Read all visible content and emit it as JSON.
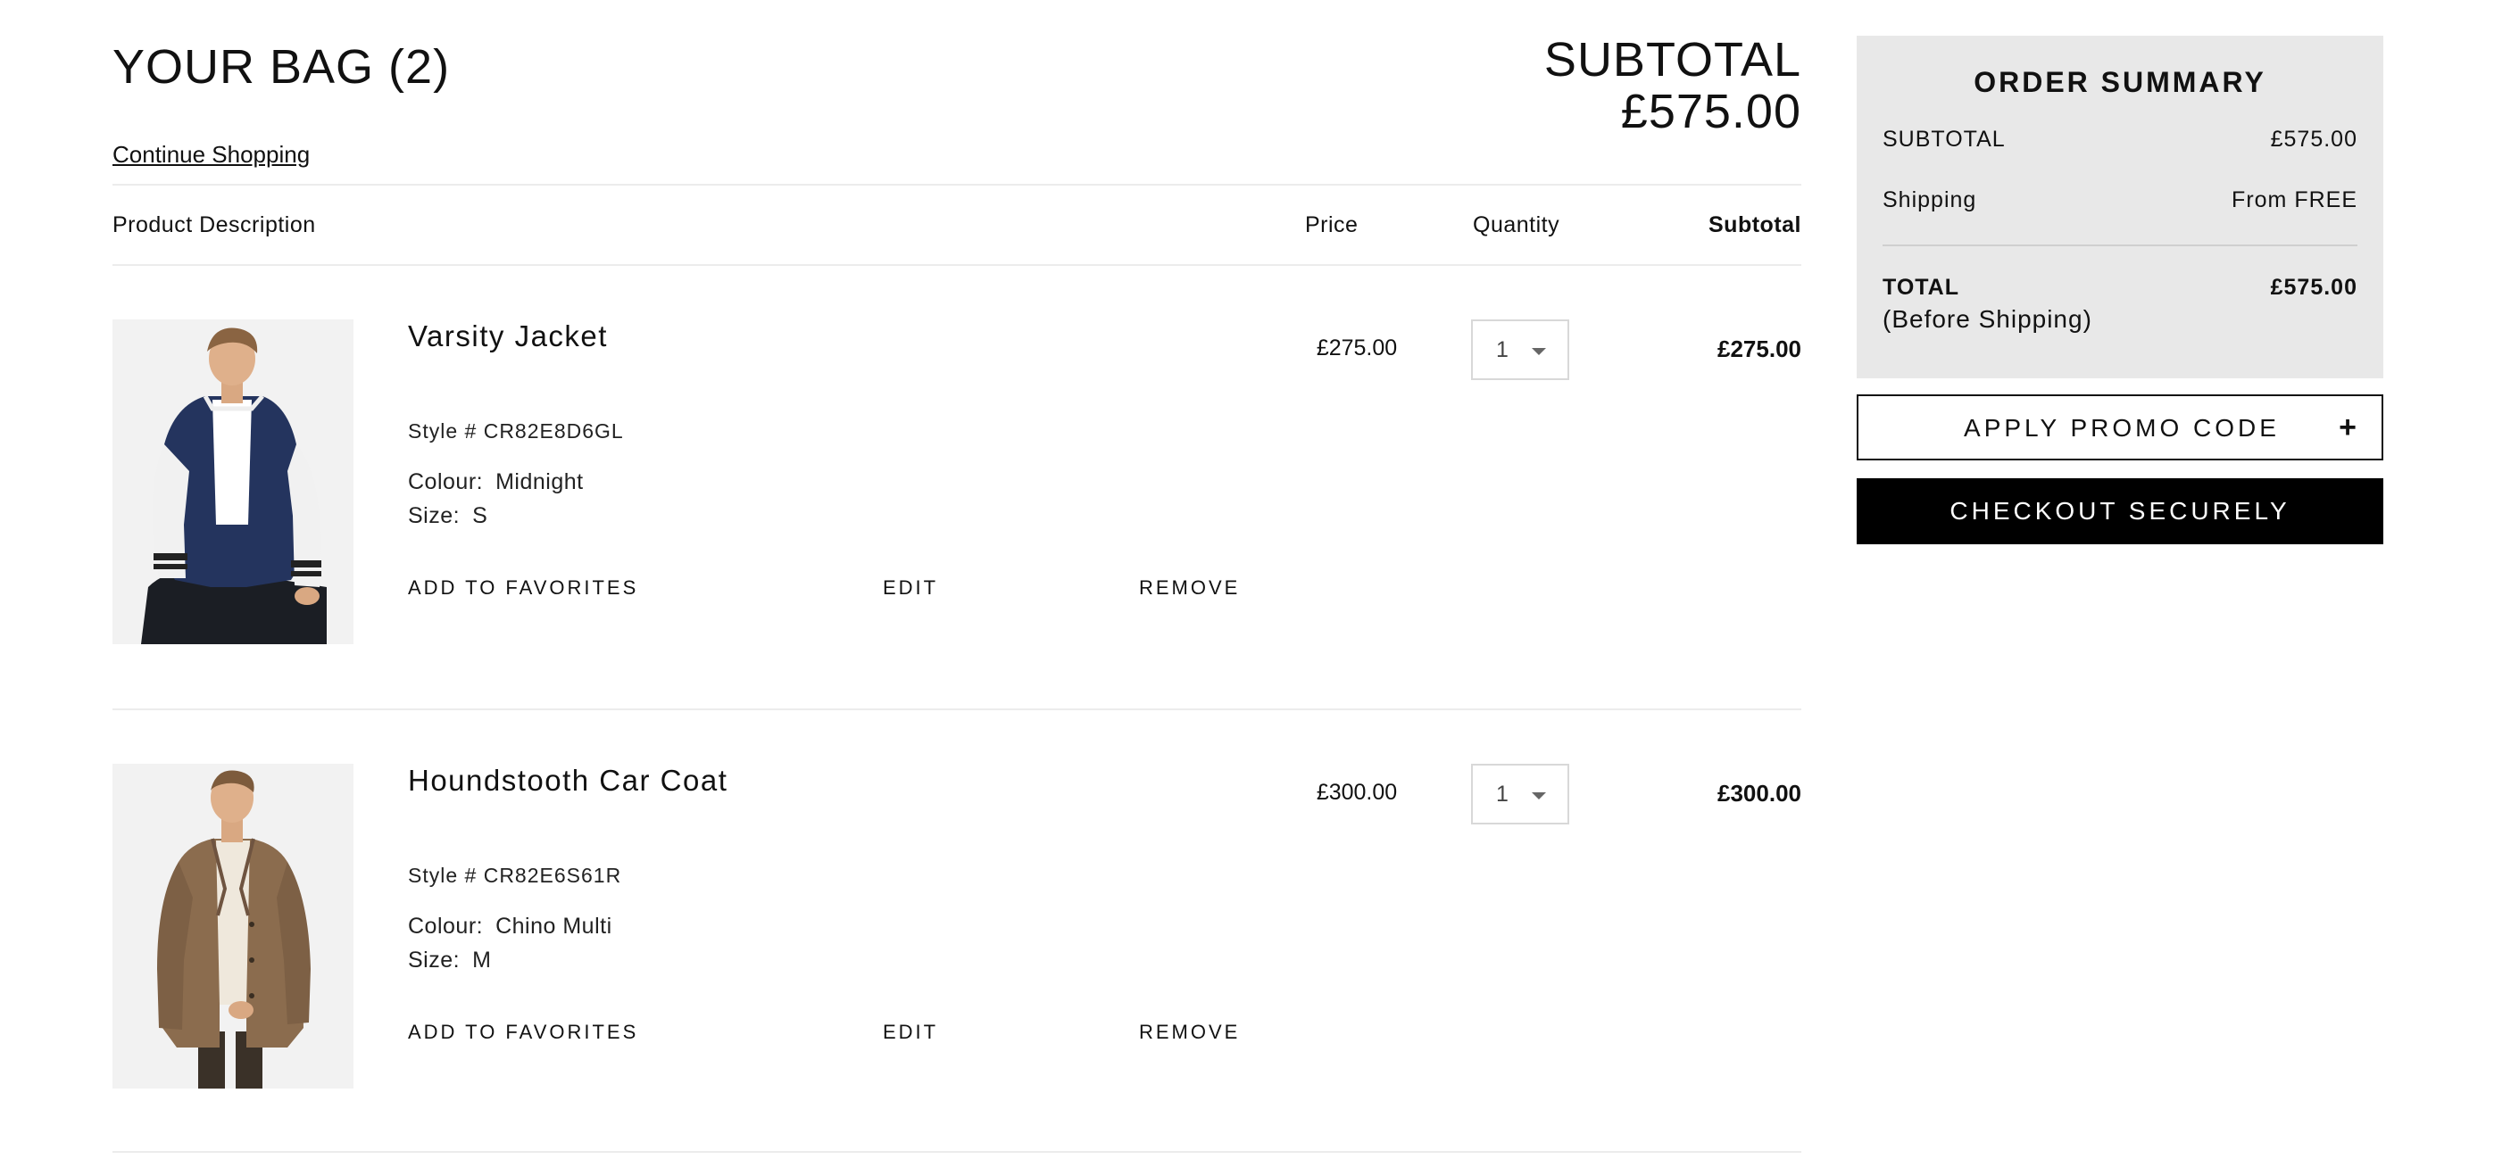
{
  "header": {
    "bag_title": "YOUR BAG (2)",
    "continue_link": "Continue Shopping",
    "subtotal_label": "SUBTOTAL",
    "subtotal_value": "£575.00"
  },
  "table": {
    "columns": {
      "description": "Product Description",
      "price": "Price",
      "quantity": "Quantity",
      "subtotal": "Subtotal"
    }
  },
  "items": [
    {
      "name": "Varsity Jacket",
      "style": "Style # CR82E8D6GL",
      "colour_label": "Colour:",
      "colour": "Midnight",
      "size_label": "Size:",
      "size": "S",
      "price": "£275.00",
      "quantity": "1",
      "subtotal": "£275.00",
      "actions": {
        "favorites": "ADD TO FAVORITES",
        "edit": "EDIT",
        "remove": "REMOVE"
      }
    },
    {
      "name": "Houndstooth Car Coat",
      "style": "Style # CR82E6S61R",
      "colour_label": "Colour:",
      "colour": "Chino Multi",
      "size_label": "Size:",
      "size": "M",
      "price": "£300.00",
      "quantity": "1",
      "subtotal": "£300.00",
      "actions": {
        "favorites": "ADD TO FAVORITES",
        "edit": "EDIT",
        "remove": "REMOVE"
      }
    }
  ],
  "summary": {
    "title": "ORDER SUMMARY",
    "subtotal_label": "SUBTOTAL",
    "subtotal_value": "£575.00",
    "shipping_label": "Shipping",
    "shipping_value": "From FREE",
    "total_label": "TOTAL",
    "total_value": "£575.00",
    "total_note": "(Before Shipping)"
  },
  "buttons": {
    "promo": "APPLY PROMO CODE",
    "promo_icon": "+",
    "checkout": "CHECKOUT SECURELY"
  },
  "icons": {
    "quantity_dropdown": "chevron-down-icon",
    "promo_expand": "plus-icon"
  },
  "colors": {
    "summary_background": "#e8e8e8",
    "checkout_background": "#000000",
    "text": "#111111"
  }
}
